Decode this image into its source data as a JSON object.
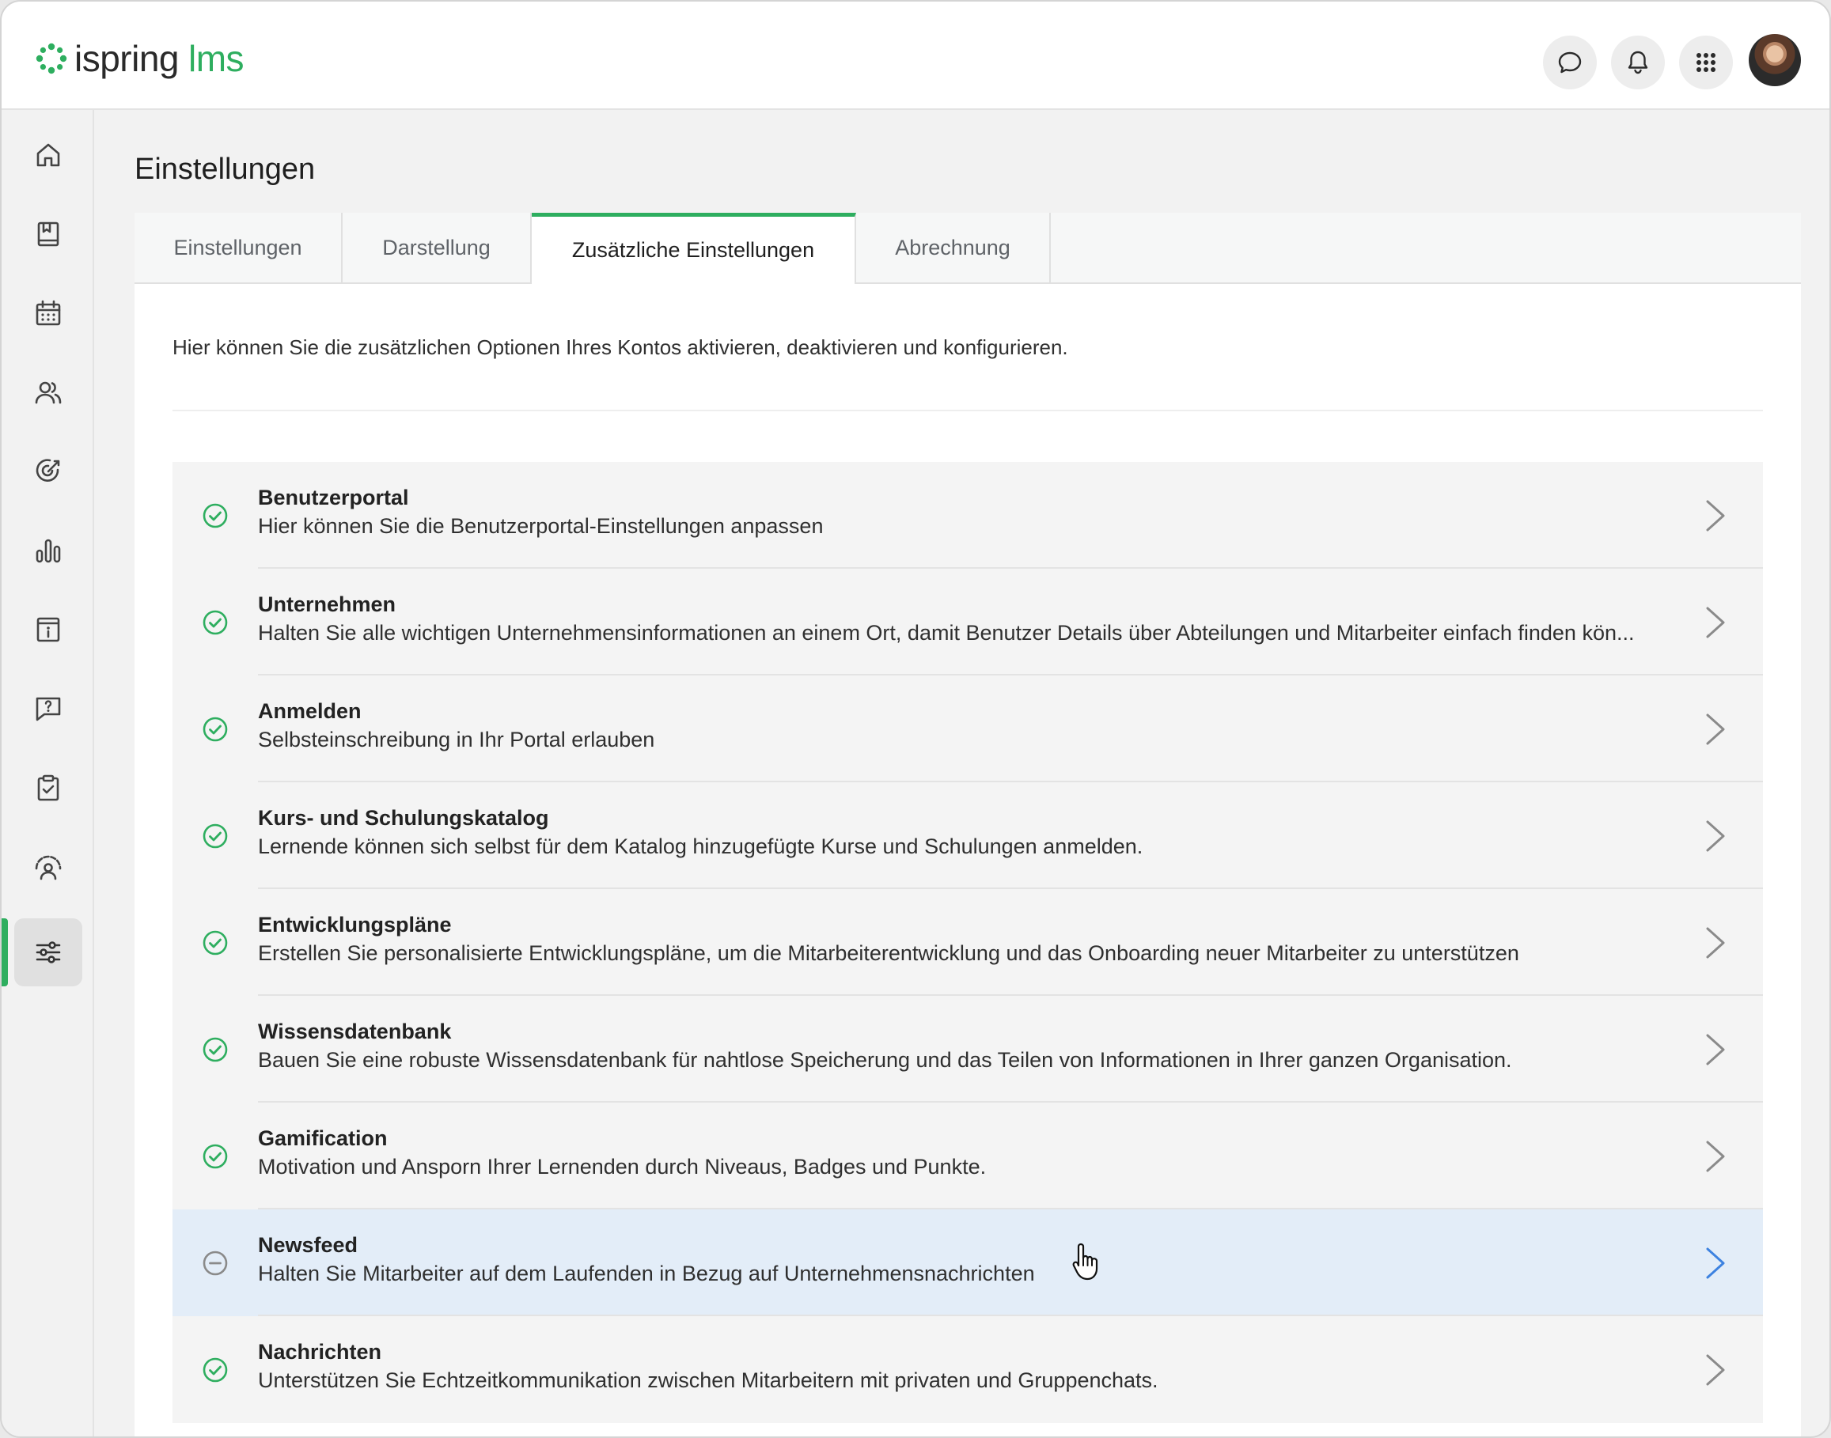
{
  "header": {
    "logo_primary": "ispring",
    "logo_secondary": "lms",
    "icons": [
      "chat-icon",
      "bell-icon",
      "apps-grid-icon"
    ],
    "avatar": "user-avatar"
  },
  "sidebar": {
    "items": [
      {
        "icon": "home-icon"
      },
      {
        "icon": "book-icon"
      },
      {
        "icon": "calendar-icon"
      },
      {
        "icon": "users-icon"
      },
      {
        "icon": "target-icon"
      },
      {
        "icon": "reports-icon"
      },
      {
        "icon": "info-board-icon"
      },
      {
        "icon": "help-chat-icon"
      },
      {
        "icon": "clipboard-check-icon"
      },
      {
        "icon": "people-gauge-icon"
      },
      {
        "icon": "settings-sliders-icon",
        "active": true
      }
    ]
  },
  "page": {
    "title": "Einstellungen",
    "tabs": [
      {
        "label": "Einstellungen"
      },
      {
        "label": "Darstellung"
      },
      {
        "label": "Zusätzliche Einstellungen",
        "active": true
      },
      {
        "label": "Abrechnung"
      }
    ],
    "intro": "Hier können Sie die zusätzlichen Optionen Ihres Kontos aktivieren, deaktivieren und konfigurieren.",
    "items": [
      {
        "title": "Benutzerportal",
        "desc": "Hier können Sie die Benutzerportal-Einstellungen anpassen",
        "status": "enabled"
      },
      {
        "title": "Unternehmen",
        "desc": "Halten Sie alle wichtigen Unternehmensinformationen an einem Ort, damit Benutzer Details über Abteilungen und Mitarbeiter einfach finden kön...",
        "status": "enabled"
      },
      {
        "title": "Anmelden",
        "desc": "Selbsteinschreibung in Ihr Portal erlauben",
        "status": "enabled"
      },
      {
        "title": "Kurs- und Schulungskatalog",
        "desc": "Lernende können sich selbst für dem Katalog hinzugefügte Kurse und Schulungen anmelden.",
        "status": "enabled"
      },
      {
        "title": "Entwicklungspläne",
        "desc": "Erstellen Sie personalisierte Entwicklungspläne, um die Mitarbeiterentwicklung und das Onboarding neuer Mitarbeiter zu unterstützen",
        "status": "enabled"
      },
      {
        "title": "Wissensdatenbank",
        "desc": "Bauen Sie eine robuste Wissensdatenbank für nahtlose Speicherung und das Teilen von Informationen in Ihrer ganzen Organisation.",
        "status": "enabled"
      },
      {
        "title": "Gamification",
        "desc": "Motivation und Ansporn Ihrer Lernenden durch Niveaus, Badges und Punkte.",
        "status": "enabled"
      },
      {
        "title": "Newsfeed",
        "desc": "Halten Sie Mitarbeiter auf dem Laufenden in Bezug auf Unternehmensnachrichten",
        "status": "disabled",
        "hover": true
      },
      {
        "title": "Nachrichten",
        "desc": "Unterstützen Sie Echtzeitkommunikation zwischen Mitarbeitern mit privaten und Gruppenchats.",
        "status": "enabled"
      }
    ]
  },
  "colors": {
    "accent": "#2eae5f",
    "hover_row": "#e3edf8",
    "chevron": "#8a8a8a",
    "chevron_hover": "#3d82e0",
    "disabled_icon": "#8a8a8a"
  }
}
